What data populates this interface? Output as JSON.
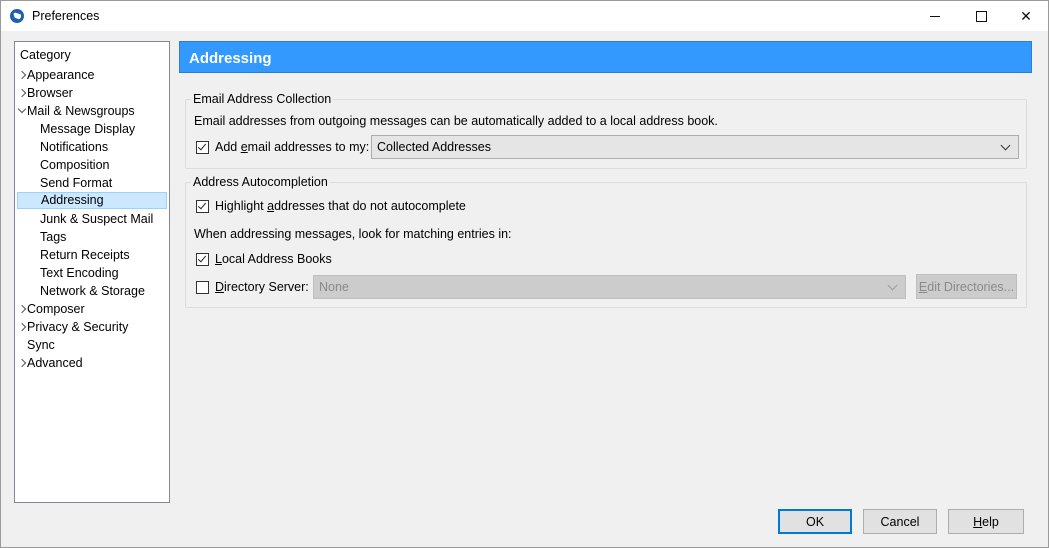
{
  "window": {
    "title": "Preferences",
    "minimize_label": "",
    "maximize_label": "",
    "close_label": "✕"
  },
  "sidebar": {
    "header": "Category",
    "items": [
      {
        "label": "Appearance",
        "level": 0,
        "expander": "collapsed"
      },
      {
        "label": "Browser",
        "level": 0,
        "expander": "collapsed"
      },
      {
        "label": "Mail & Newsgroups",
        "level": 0,
        "expander": "expanded"
      },
      {
        "label": "Message Display",
        "level": 1
      },
      {
        "label": "Notifications",
        "level": 1
      },
      {
        "label": "Composition",
        "level": 1
      },
      {
        "label": "Send Format",
        "level": 1
      },
      {
        "label": "Addressing",
        "level": 1,
        "selected": true
      },
      {
        "label": "Junk & Suspect Mail",
        "level": 1
      },
      {
        "label": "Tags",
        "level": 1
      },
      {
        "label": "Return Receipts",
        "level": 1
      },
      {
        "label": "Text Encoding",
        "level": 1
      },
      {
        "label": "Network & Storage",
        "level": 1
      },
      {
        "label": "Composer",
        "level": 0,
        "expander": "collapsed"
      },
      {
        "label": "Privacy & Security",
        "level": 0,
        "expander": "collapsed"
      },
      {
        "label": "Sync",
        "level": 0
      },
      {
        "label": "Advanced",
        "level": 0,
        "expander": "collapsed"
      }
    ]
  },
  "main": {
    "header_title": "Addressing",
    "email_collection": {
      "legend": "Email Address Collection",
      "description": "Email addresses from outgoing messages can be automatically added to a local address book.",
      "add_checkbox_label_pre": "Add ",
      "add_checkbox_label_accel": "e",
      "add_checkbox_label_post": "mail addresses to my:",
      "add_checked": true,
      "address_book_value": "Collected Addresses"
    },
    "autocompletion": {
      "legend": "Address Autocompletion",
      "highlight_label_pre": "Highlight ",
      "highlight_label_accel": "a",
      "highlight_label_post": "ddresses that do not autocomplete",
      "highlight_checked": true,
      "lookup_text": "When addressing messages, look for matching entries in:",
      "local_books_label_pre": "",
      "local_books_label_accel": "L",
      "local_books_label_post": "ocal Address Books",
      "local_books_checked": true,
      "directory_label_pre": "",
      "directory_label_accel": "D",
      "directory_label_post": "irectory Server:",
      "directory_checked": false,
      "directory_value": "None",
      "edit_directories_accel": "E",
      "edit_directories_post": "dit Directories..."
    }
  },
  "buttons": {
    "ok": "OK",
    "cancel": "Cancel",
    "help_accel": "H",
    "help_post": "elp"
  },
  "colors": {
    "header_blue": "#3399ff",
    "selection": "#cce8ff",
    "default_button_border": "#0078d7"
  }
}
